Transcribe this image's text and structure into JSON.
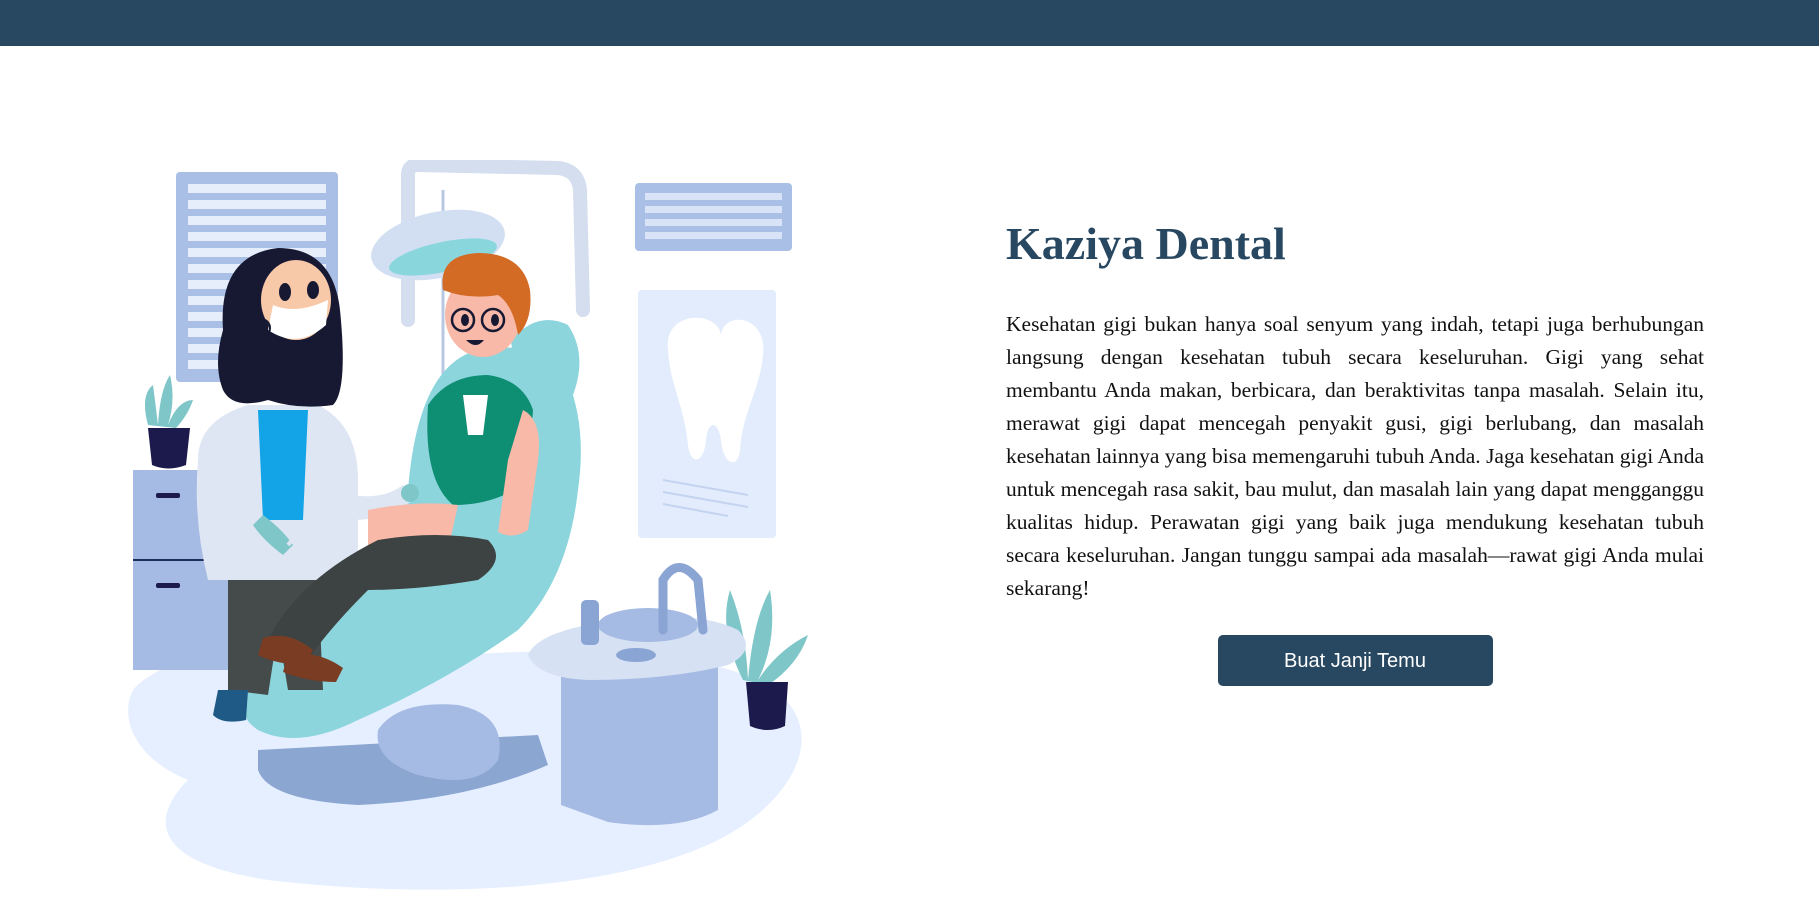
{
  "hero": {
    "title": "Kaziya Dental",
    "description": "Kesehatan gigi bukan hanya soal senyum yang indah, tetapi juga berhubungan langsung dengan kesehatan tubuh secara keseluruhan. Gigi yang sehat membantu Anda makan, berbicara, dan beraktivitas tanpa masalah. Selain itu, merawat gigi dapat mencegah penyakit gusi, gigi berlubang, dan masalah kesehatan lainnya yang bisa memengaruhi tubuh Anda. Jaga kesehatan gigi Anda untuk mencegah rasa sakit, bau mulut, dan masalah lain yang dapat mengganggu kualitas hidup. Perawatan gigi yang baik juga mendukung kesehatan tubuh secara keseluruhan. Jangan tunggu sampai ada masalah—rawat gigi Anda mulai sekarang!",
    "cta_label": "Buat Janji Temu",
    "illustration": "dentist-examining-patient-illustration"
  },
  "colors": {
    "brand": "#284862",
    "text": "#111111",
    "background": "#ffffff"
  }
}
